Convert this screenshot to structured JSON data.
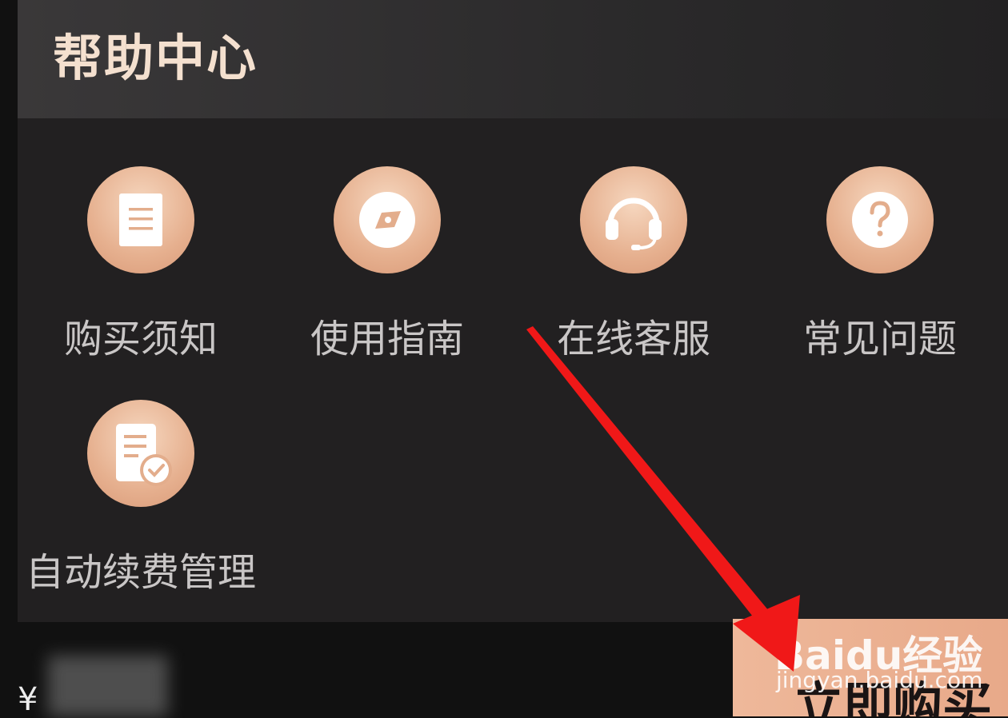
{
  "header": {
    "title": "帮助中心"
  },
  "items": [
    {
      "label": "购买须知",
      "icon": "document-icon"
    },
    {
      "label": "使用指南",
      "icon": "compass-icon"
    },
    {
      "label": "在线客服",
      "icon": "headset-icon"
    },
    {
      "label": "常见问题",
      "icon": "question-icon"
    },
    {
      "label": "自动续费管理",
      "icon": "document-check-icon"
    }
  ],
  "footer": {
    "currency": "¥",
    "buy_label": "立即购买"
  },
  "watermark": {
    "logo": "Baidu经验",
    "url": "jingyan.baidu.com"
  },
  "colors": {
    "accent": "#e6b08f",
    "title": "#f4e0cf",
    "arrow": "#f01818"
  }
}
